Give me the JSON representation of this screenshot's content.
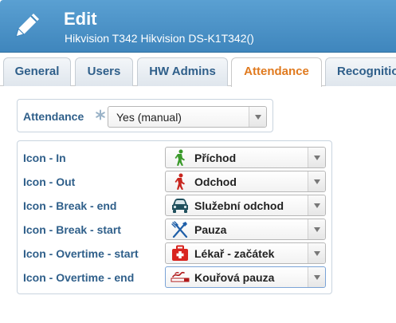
{
  "header": {
    "title": "Edit",
    "subtitle": "Hikvision T342 Hikvision DS-K1T342()",
    "icon": "pencil-icon"
  },
  "tabs": [
    {
      "label": "General",
      "active": false
    },
    {
      "label": "Users",
      "active": false
    },
    {
      "label": "HW Admins",
      "active": false
    },
    {
      "label": "Attendance",
      "active": true
    },
    {
      "label": "Recognition",
      "active": false
    }
  ],
  "attendance": {
    "label": "Attendance",
    "required_icon": "asterisk-icon",
    "value": "Yes (manual)"
  },
  "icons": [
    {
      "label": "Icon - In",
      "value": "Příchod",
      "icon": "walking-person-green-icon"
    },
    {
      "label": "Icon - Out",
      "value": "Odchod",
      "icon": "walking-person-red-icon"
    },
    {
      "label": "Icon - Break - end",
      "value": "Služební odchod",
      "icon": "car-icon"
    },
    {
      "label": "Icon - Break - start",
      "value": "Pauza",
      "icon": "fork-knife-icon"
    },
    {
      "label": "Icon - Overtime - start",
      "value": "Lékař - začátek",
      "icon": "first-aid-kit-icon"
    },
    {
      "label": "Icon - Overtime - end",
      "value": "Kouřová pauza",
      "icon": "cigarette-icon"
    }
  ],
  "colors": {
    "header": "#4a93c9",
    "active_tab": "#e07a1f",
    "label": "#2f5f8a"
  }
}
